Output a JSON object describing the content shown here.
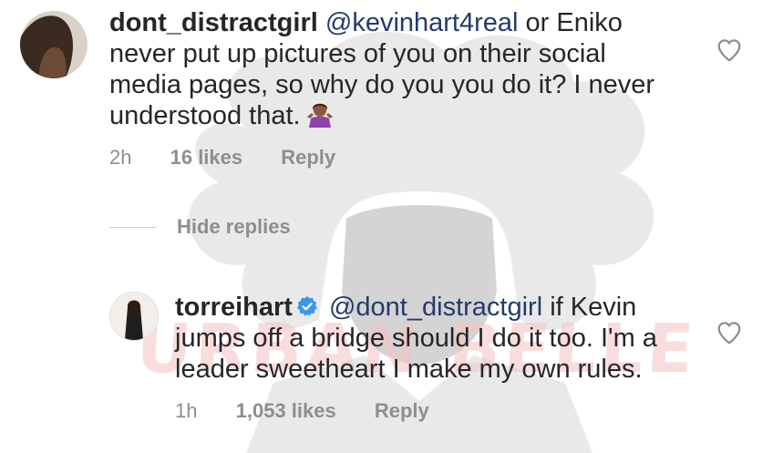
{
  "watermark": {
    "text": "URBAN BELLE"
  },
  "comment1": {
    "username": "dont_distractgirl",
    "mention": "@kevinhart4real",
    "text": "or Eniko never put up pictures of you on their social media pages, so why do you you do it? I never understood that.",
    "emoji": "woman-shrugging-emoji",
    "time": "2h",
    "likes": "16 likes",
    "reply": "Reply",
    "like_icon": "heart-icon"
  },
  "hide_replies": "Hide replies",
  "comment2": {
    "username": "torreihart",
    "verified_icon": "verified-badge-icon",
    "mention": "@dont_distractgirl",
    "text": "if Kevin jumps off a bridge should I do it too. I'm a leader sweetheart I make my own rules.",
    "time": "1h",
    "likes": "1,053 likes",
    "reply": "Reply",
    "like_icon": "heart-icon"
  },
  "colors": {
    "verified": "#3897f0",
    "meta": "#8e8e8e",
    "mention": "#243b6b"
  }
}
